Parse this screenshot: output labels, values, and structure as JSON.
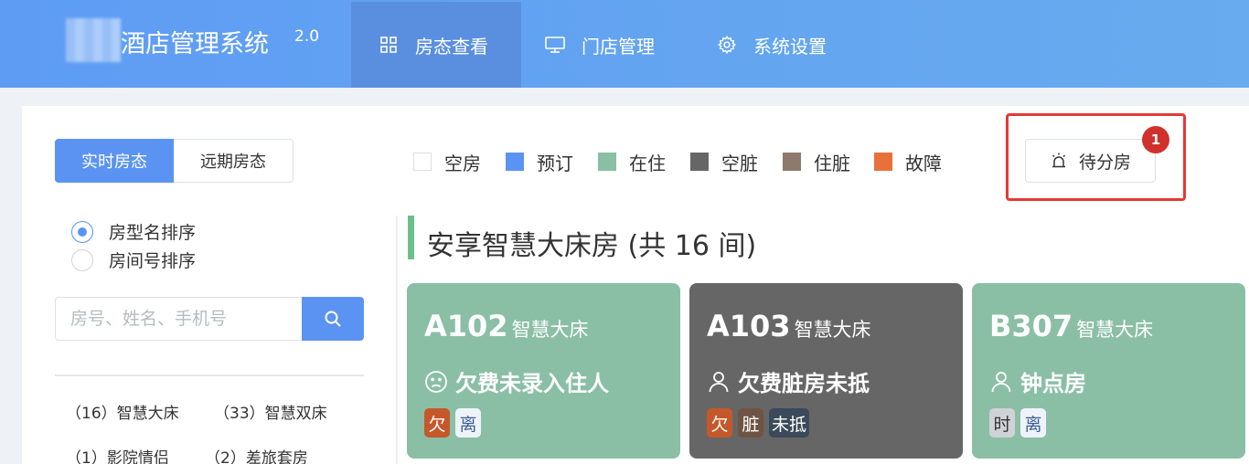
{
  "header": {
    "title": "酒店管理系统",
    "version": "2.0",
    "nav": [
      {
        "label": "房态查看",
        "icon": "grid-icon",
        "active": true
      },
      {
        "label": "门店管理",
        "icon": "monitor-icon",
        "active": false
      },
      {
        "label": "系统设置",
        "icon": "gear-icon",
        "active": false
      }
    ]
  },
  "view_toggle": {
    "realtime": "实时房态",
    "future": "远期房态"
  },
  "legend": [
    {
      "label": "空房",
      "color": "#ffffff"
    },
    {
      "label": "预订",
      "color": "#5b93f2"
    },
    {
      "label": "在住",
      "color": "#8abfa5"
    },
    {
      "label": "空脏",
      "color": "#666666"
    },
    {
      "label": "住脏",
      "color": "#8d7a6c"
    },
    {
      "label": "故障",
      "color": "#e8703a"
    }
  ],
  "pending": {
    "label": "待分房",
    "count": "1"
  },
  "sort": {
    "by_type": "房型名排序",
    "by_number": "房间号排序",
    "selected": "by_type"
  },
  "search": {
    "placeholder": "房号、姓名、手机号"
  },
  "categories": [
    "（16）智慧大床",
    "（33）智慧双床",
    "（1）影院情侣",
    "（2）差旅套房"
  ],
  "group": {
    "title": "安享智慧大床房 (共 16 间)"
  },
  "rooms": [
    {
      "number": "A102",
      "type": "智慧大床",
      "status": "欠费未录入住人",
      "status_icon": "sad-face-icon",
      "bg": "#8abfa5",
      "tags": [
        {
          "text": "欠",
          "bg": "#c5582a",
          "fg": "#ffffff"
        },
        {
          "text": "离",
          "bg": "#eef3fa",
          "fg": "#3b5f93"
        }
      ]
    },
    {
      "number": "A103",
      "type": "智慧大床",
      "status": "欠费脏房未抵",
      "status_icon": "person-icon",
      "bg": "#666666",
      "tags": [
        {
          "text": "欠",
          "bg": "#c5582a",
          "fg": "#ffffff"
        },
        {
          "text": "脏",
          "bg": "#6e5443",
          "fg": "#ffffff"
        },
        {
          "text": "未抵",
          "bg": "#3a4a5a",
          "fg": "#ffffff"
        }
      ]
    },
    {
      "number": "B307",
      "type": "智慧大床",
      "status": "钟点房",
      "status_icon": "person-icon",
      "bg": "#8abfa5",
      "tags": [
        {
          "text": "时",
          "bg": "#cfd2d6",
          "fg": "#333333"
        },
        {
          "text": "离",
          "bg": "#eef3fa",
          "fg": "#3b5f93"
        }
      ]
    }
  ]
}
